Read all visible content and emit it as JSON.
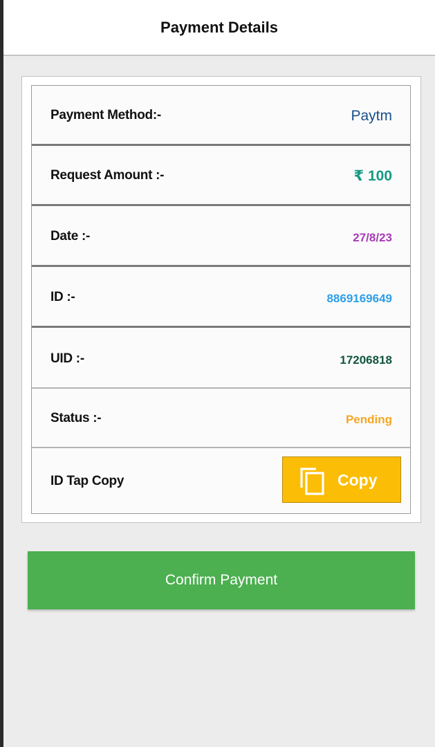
{
  "header": {
    "title": "Payment Details"
  },
  "details": {
    "payment_method_label": "Payment Method:-",
    "payment_method_value": "Paytm",
    "request_amount_label": "Request Amount :-",
    "request_amount_value": "₹ 100",
    "date_label": "Date :-",
    "date_value": "27/8/23",
    "id_label": "ID :-",
    "id_value": "8869169649",
    "uid_label": "UID :-",
    "uid_value": "17206818",
    "status_label": "Status :-",
    "status_value": "Pending",
    "copy_row_label": "ID Tap Copy",
    "copy_button_label": "Copy",
    "copy_icon": "copy-icon"
  },
  "actions": {
    "confirm_label": "Confirm Payment"
  },
  "colors": {
    "confirm_green": "#4caf50",
    "copy_yellow": "#fbbd06",
    "method_blue": "#1a4f8a",
    "amount_teal": "#149a86",
    "date_purple": "#a83bb8",
    "id_blue": "#2e9ee8",
    "uid_green": "#11553f",
    "status_orange": "#f5a623"
  }
}
